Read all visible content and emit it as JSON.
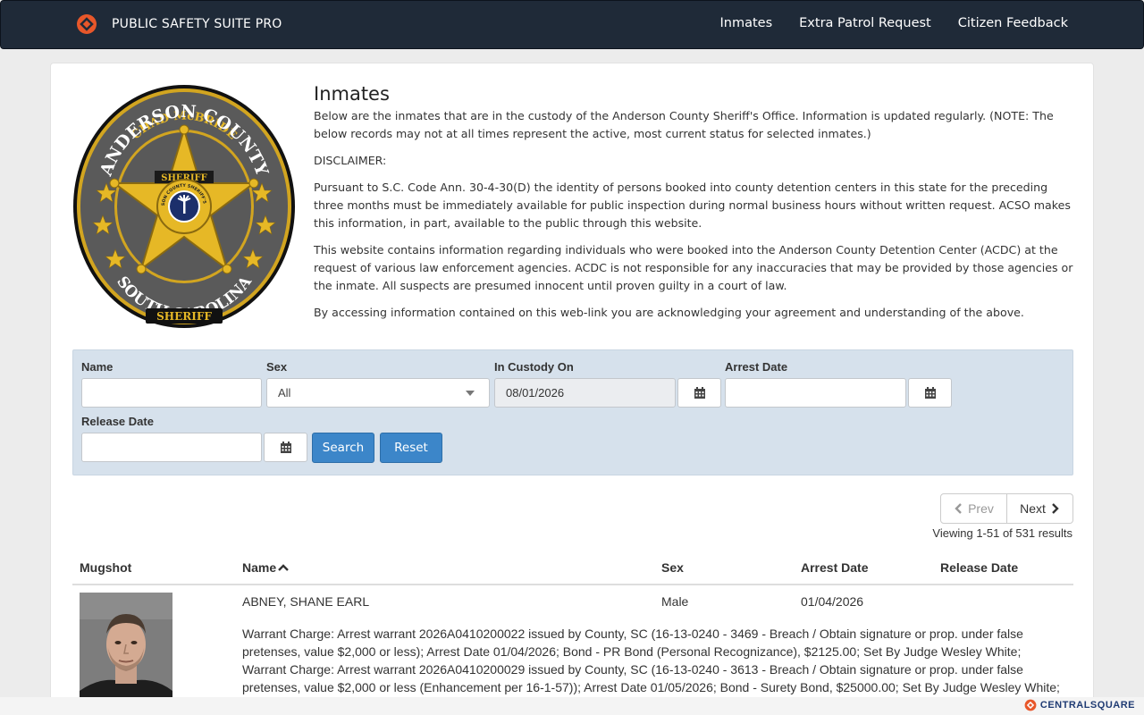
{
  "navbar": {
    "brand": "PUBLIC SAFETY SUITE PRO",
    "links": [
      "Inmates",
      "Extra Patrol Request",
      "Citizen Feedback"
    ]
  },
  "seal": {
    "top_arc": "CHAD McBRIDE",
    "county_arc": "ANDERSON COUNTY",
    "star_word": "SHERIFF",
    "center_ring": "ANDERSON COUNTY SHERIFF'S OFFICE",
    "bottom_arc": "SOUTH CAROLINA",
    "bottom_word": "SHERIFF"
  },
  "intro": {
    "title": "Inmates",
    "p1": "Below are the inmates that are in the custody of the Anderson County Sheriff's Office. Information is updated regularly. (NOTE: The below records may not at all times represent the active, most current status for selected inmates.)",
    "p2": "DISCLAIMER:",
    "p3": "Pursuant to S.C. Code Ann. 30-4-30(D) the identity of persons booked into county detention centers in this state for the preceding three months must be immediately available for public inspection during normal business hours without written request.  ACSO makes this information, in part, available to the public through this website.",
    "p4": "This website contains information regarding individuals who were booked into the Anderson County Detention Center (ACDC) at the request of various law enforcement agencies.  ACDC is not responsible for any inaccuracies that may be provided by those agencies or the inmate.  All suspects are presumed innocent until proven guilty in a court of law.",
    "p5": "By accessing information contained on this web-link you are acknowledging your agreement and understanding of the above."
  },
  "search": {
    "name_label": "Name",
    "name_value": "",
    "sex_label": "Sex",
    "sex_value": "All",
    "custody_label": "In Custody On",
    "custody_value": "08/01/2026",
    "arrest_label": "Arrest Date",
    "arrest_value": "",
    "release_label": "Release Date",
    "release_value": "",
    "search_button": "Search",
    "reset_button": "Reset"
  },
  "pager": {
    "prev": "Prev",
    "next": "Next",
    "results": "Viewing 1-51 of 531 results"
  },
  "table": {
    "headers": [
      "Mugshot",
      "Name",
      "Sex",
      "Arrest Date",
      "Release Date"
    ],
    "rows": [
      {
        "name": "ABNEY, SHANE EARL",
        "sex": "Male",
        "arrest_date": "01/04/2026",
        "release_date": "",
        "charges": "Warrant Charge: Arrest warrant 2026A0410200022 issued by County, SC (16-13-0240 - 3469 - Breach / Obtain signature or prop. under false pretenses, value $2,000 or less); Arrest Date 01/04/2026; Bond - PR Bond (Personal Recognizance), $2125.00; Set By Judge Wesley White; Warrant Charge: Arrest warrant 2026A0410200029 issued by County, SC (16-13-0240 - 3613 - Breach / Obtain signature or prop. under false pretenses, value $2,000 or less (Enhancement per 16-1-57)); Arrest Date 01/05/2026; Bond - Surety Bond, $25000.00; Set By Judge Wesley White;"
      }
    ]
  },
  "footer": {
    "brand": "CENTRALSQUARE"
  },
  "colors": {
    "navbar_bg": "#1f2a38",
    "accent_orange": "#e8572a",
    "button_blue": "#3c86c9",
    "search_bg": "#d6e1ec"
  }
}
